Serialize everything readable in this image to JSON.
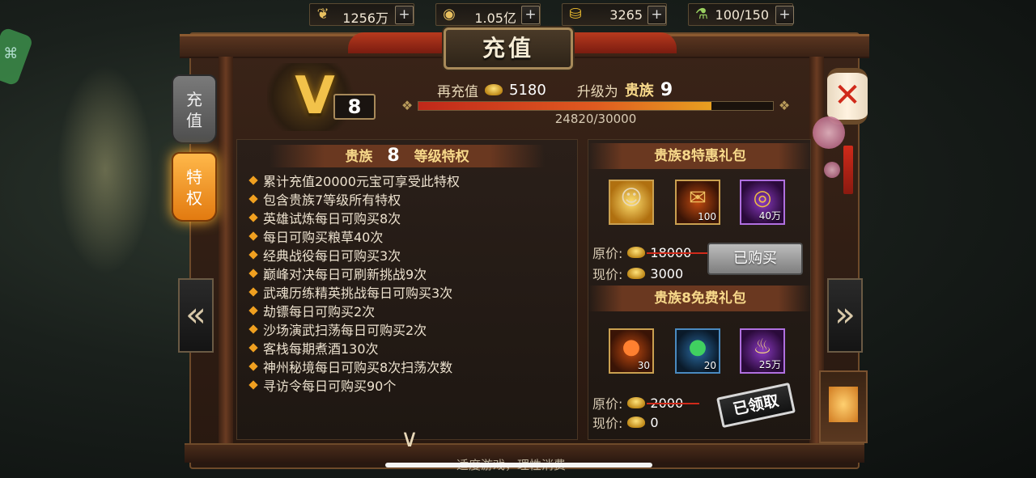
{
  "resources": [
    {
      "icon": "grain-icon",
      "value": "1256万",
      "plus": "+"
    },
    {
      "icon": "copper-coin-icon",
      "value": "1.05亿",
      "plus": "+"
    },
    {
      "icon": "gold-ingot-icon",
      "value": "3265",
      "plus": "+"
    },
    {
      "icon": "stamina-potion-icon",
      "value": "100/150",
      "plus": "+"
    }
  ],
  "window": {
    "title": "充值"
  },
  "side_tabs": [
    {
      "label_top": "充",
      "label_bottom": "值",
      "active": false
    },
    {
      "label_top": "特",
      "label_bottom": "权",
      "active": true
    }
  ],
  "vip": {
    "current_level": "8",
    "recharge_label": "再充值",
    "recharge_amount": "5180",
    "upgrade_label": "升级为",
    "next_rank_name": "贵族",
    "next_rank_level": "9",
    "progress_text": "24820/30000",
    "progress_fraction": 0.8273
  },
  "privileges": {
    "header_prefix": "贵族",
    "header_level": "8",
    "header_suffix": "等级特权",
    "items": [
      "累计充值20000元宝可享受此特权",
      "包含贵族7等级所有特权",
      "英雄试炼每日可购买8次",
      "每日可购买粮草40次",
      "经典战役每日可购买3次",
      "巅峰对决每日可刷新挑战9次",
      "武魂历练精英挑战每日可购买3次",
      "劫镖每日可购买2次",
      "沙场演武扫荡每日可购买2次",
      "客栈每期煮酒130次",
      "神州秘境每日可购买8次扫荡次数",
      "寻访令每日可购买90个"
    ]
  },
  "special_pack": {
    "title": "贵族8特惠礼包",
    "items": [
      {
        "icon": "hero-portrait-icon",
        "qty": ""
      },
      {
        "icon": "scroll-icon",
        "qty": "100"
      },
      {
        "icon": "coin-pile-icon",
        "qty": "40万"
      }
    ],
    "original_label": "原价:",
    "original_price": "18000",
    "current_label": "现价:",
    "current_price": "3000",
    "button_label": "已购买"
  },
  "free_pack": {
    "title": "贵族8免费礼包",
    "items": [
      {
        "icon": "fire-orb-icon",
        "qty": "30"
      },
      {
        "icon": "jade-orb-icon",
        "qty": "20"
      },
      {
        "icon": "money-bag-icon",
        "qty": "25万"
      }
    ],
    "original_label": "原价:",
    "original_price": "2000",
    "current_label": "现价:",
    "current_price": "0",
    "stamp_label": "已领取"
  },
  "footer": {
    "text": "适度游戏，理性消费"
  },
  "colors": {
    "accent_gold": "#f7d88a",
    "progress_red": "#c0281a",
    "panel_bg": "#2a1f19"
  }
}
